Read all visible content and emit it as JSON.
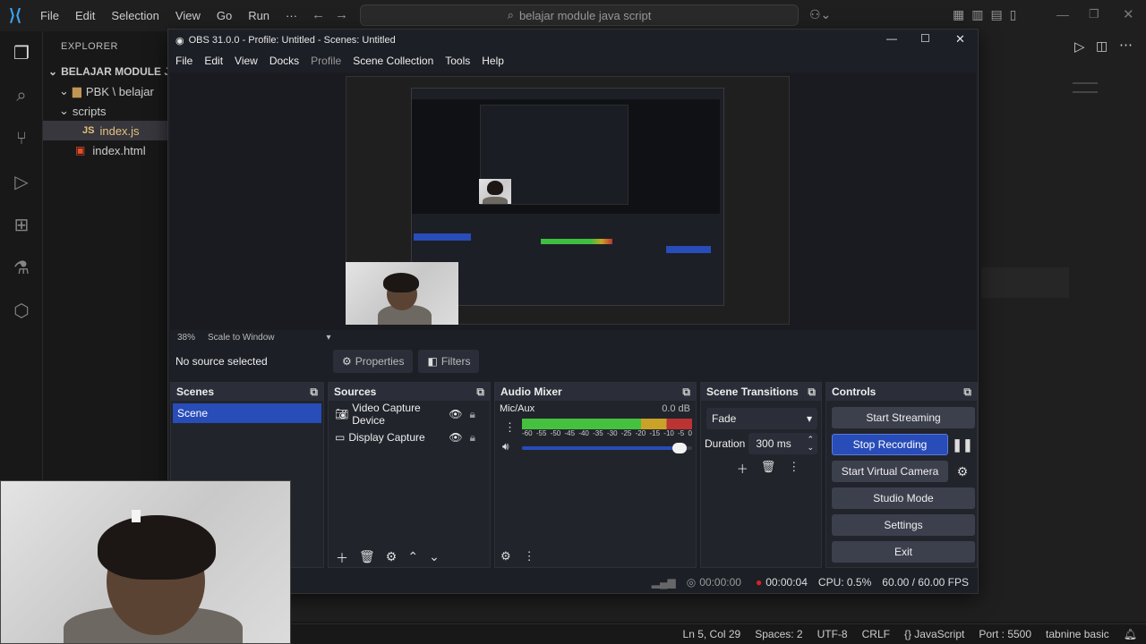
{
  "vscode": {
    "menu": [
      "File",
      "Edit",
      "Selection",
      "View",
      "Go",
      "Run",
      "···"
    ],
    "search": "belajar module java script",
    "explorer_title": "EXPLORER",
    "tree": [
      {
        "label": "BELAJAR MODULE JAVA..."
      },
      {
        "label": "PBK \\ belajar"
      },
      {
        "label": "scripts"
      },
      {
        "label": "index.js"
      },
      {
        "label": "index.html"
      }
    ],
    "status": [
      "Ln 5, Col 29",
      "Spaces: 2",
      "UTF-8",
      "CRLF",
      "{} JavaScript",
      "Port : 5500",
      "tabnine basic"
    ]
  },
  "obs": {
    "title": "OBS 31.0.0 - Profile: Untitled - Scenes: Untitled",
    "menu": [
      "File",
      "Edit",
      "View",
      "Docks",
      "Profile",
      "Scene Collection",
      "Tools",
      "Help"
    ],
    "zoom": "38%",
    "scale_mode": "Scale to Window",
    "no_source": "No source selected",
    "properties": "Properties",
    "filters": "Filters",
    "scenes_title": "Scenes",
    "scene_item": "Scene",
    "sources_title": "Sources",
    "sources": [
      "Video Capture Device",
      "Display Capture"
    ],
    "mixer_title": "Audio Mixer",
    "mixer_channel": "Mic/Aux",
    "mixer_db": "0.0 dB",
    "meter_ticks": [
      "-60",
      "-55",
      "-50",
      "-45",
      "-40",
      "-35",
      "-30",
      "-25",
      "-20",
      "-15",
      "-10",
      "-5",
      "0"
    ],
    "volume_level": 0.97,
    "transitions_title": "Scene Transitions",
    "transition": "Fade",
    "duration_label": "Duration",
    "duration_value": "300 ms",
    "controls_title": "Controls",
    "controls": {
      "start_streaming": "Start Streaming",
      "stop_recording": "Stop Recording",
      "start_virtual_camera": "Start Virtual Camera",
      "studio_mode": "Studio Mode",
      "settings": "Settings",
      "exit": "Exit"
    },
    "status": {
      "stream_time": "00:00:00",
      "rec_time": "00:00:04",
      "cpu": "CPU: 0.5%",
      "fps": "60.00 / 60.00 FPS"
    },
    "accent": "#284cb8"
  }
}
